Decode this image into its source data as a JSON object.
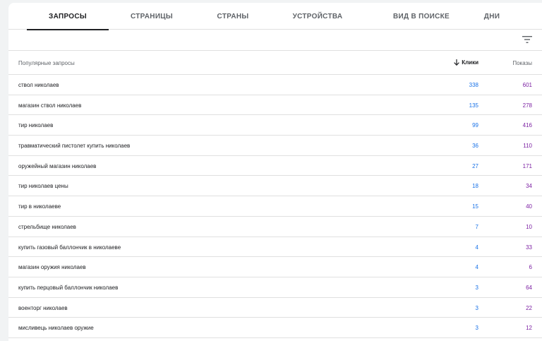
{
  "tabs": [
    "ЗАПРОСЫ",
    "СТРАНИЦЫ",
    "СТРАНЫ",
    "УСТРОЙСТВА",
    "ВИД В ПОИСКЕ",
    "ДНИ"
  ],
  "active_tab": 0,
  "table": {
    "headers": {
      "query": "Популярные запросы",
      "clicks": "Клики",
      "impressions": "Показы"
    },
    "sort": "clicks-desc",
    "rows": [
      {
        "query": "ствол николаев",
        "clicks": "338",
        "impressions": "601"
      },
      {
        "query": "магазин ствол николаев",
        "clicks": "135",
        "impressions": "278"
      },
      {
        "query": "тир николаев",
        "clicks": "99",
        "impressions": "416"
      },
      {
        "query": "травматический пистолет купить николаев",
        "clicks": "36",
        "impressions": "110"
      },
      {
        "query": "оружейный магазин николаев",
        "clicks": "27",
        "impressions": "171"
      },
      {
        "query": "тир николаев цены",
        "clicks": "18",
        "impressions": "34"
      },
      {
        "query": "тир в николаеве",
        "clicks": "15",
        "impressions": "40"
      },
      {
        "query": "стрельбище николаев",
        "clicks": "7",
        "impressions": "10"
      },
      {
        "query": "купить газовый баллончик в николаеве",
        "clicks": "4",
        "impressions": "33"
      },
      {
        "query": "магазин оружия николаев",
        "clicks": "4",
        "impressions": "6"
      },
      {
        "query": "купить перцовый баллончик николаев",
        "clicks": "3",
        "impressions": "64"
      },
      {
        "query": "военторг николаев",
        "clicks": "3",
        "impressions": "22"
      },
      {
        "query": "мисливець николаев оружие",
        "clicks": "3",
        "impressions": "12"
      }
    ]
  },
  "icons": {
    "filter": "filter-list-icon",
    "sort": "arrow-down-icon"
  },
  "colors": {
    "clicks": "#1a73e8",
    "impressions": "#7b1fa2",
    "active_tab": "#202124"
  }
}
